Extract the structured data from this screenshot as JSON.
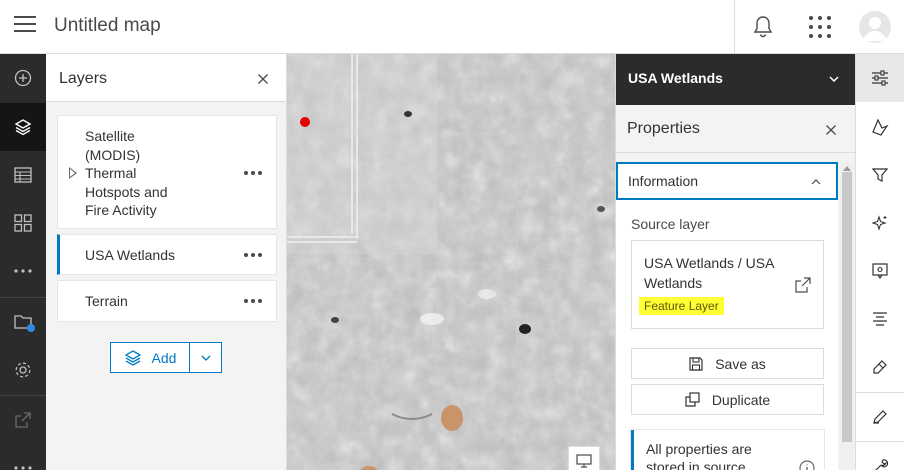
{
  "header": {
    "title": "Untitled map",
    "menu_icon": "hamburger-icon",
    "notifications_icon": "bell-icon",
    "apps_icon": "app-launcher-icon",
    "avatar_icon": "user-avatar-icon"
  },
  "actionbar": {
    "items": [
      {
        "name": "add",
        "icon": "add-circle-icon"
      },
      {
        "name": "layers",
        "icon": "layers-icon",
        "active": true
      },
      {
        "name": "tables",
        "icon": "table-icon"
      },
      {
        "name": "basemap",
        "icon": "basemap-grid-icon"
      },
      {
        "name": "more",
        "icon": "ellipsis-icon"
      },
      {
        "name": "map-properties",
        "icon": "map-properties-icon"
      },
      {
        "name": "settings",
        "icon": "gear-icon"
      },
      {
        "name": "share",
        "icon": "share-icon"
      },
      {
        "name": "more-bottom",
        "icon": "ellipsis-icon"
      }
    ]
  },
  "layers_panel": {
    "title": "Layers",
    "items": [
      {
        "label": "Satellite (MODIS) Thermal Hotspots and Fire Activity",
        "lines": [
          "Satellite",
          "(MODIS)",
          "Thermal",
          "Hotspots and",
          "Fire Activity"
        ],
        "expandable": true
      },
      {
        "label": "USA Wetlands",
        "selected": true
      },
      {
        "label": "Terrain"
      }
    ],
    "add_label": "Add"
  },
  "properties_panel": {
    "layer_selector": "USA Wetlands",
    "title": "Properties",
    "section_title": "Information",
    "source_layer_label": "Source layer",
    "source_name": "USA Wetlands / USA Wetlands",
    "source_type": "Feature Layer",
    "save_as_label": "Save as",
    "duplicate_label": "Duplicate",
    "notice_text": "All properties are stored in source"
  },
  "colors": {
    "accent": "#007ac2",
    "actionbar_bg": "#2b2b2b",
    "tag_highlight": "#ffff33",
    "fire_point": "#e60000",
    "wetland_fill": "#c8946b"
  },
  "tools": [
    "properties-sliders-icon",
    "styles-icon",
    "filter-icon",
    "effects-sparkle-icon",
    "popups-icon",
    "labels-icon",
    "sketch-eraser-icon",
    "edit-icon",
    "analysis-wrench-icon"
  ]
}
